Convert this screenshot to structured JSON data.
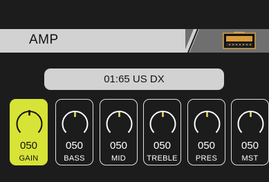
{
  "header": {
    "title": "AMP",
    "icon": "amp-head-icon"
  },
  "preset": {
    "name": "01:65 US DX"
  },
  "colors": {
    "accent": "#d7e337",
    "panel": "#d2d2d2",
    "background": "#1c1c1c",
    "needle": "#e8e06a"
  },
  "knobs": [
    {
      "label": "GAIN",
      "value": "050",
      "active": true
    },
    {
      "label": "BASS",
      "value": "050",
      "active": false
    },
    {
      "label": "MID",
      "value": "050",
      "active": false
    },
    {
      "label": "TREBLE",
      "value": "050",
      "active": false
    },
    {
      "label": "PRES",
      "value": "050",
      "active": false
    },
    {
      "label": "MST",
      "value": "050",
      "active": false
    }
  ]
}
